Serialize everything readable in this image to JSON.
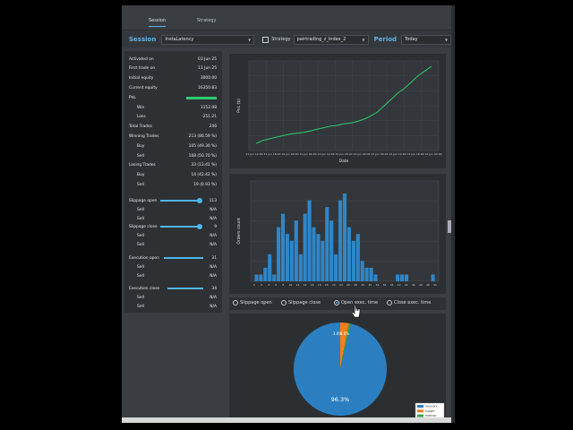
{
  "tabs": [
    {
      "label": "Session",
      "active": true
    },
    {
      "label": "Strategy",
      "active": false
    }
  ],
  "toolbar": {
    "session_label": "Session",
    "session_value": "InstaLatency",
    "strategy_checkbox_checked": false,
    "strategy_label": "Strategy",
    "strategy_value": "pairtrading_z_index_2",
    "period_label": "Period",
    "period_value": "Today"
  },
  "stats": [
    {
      "label": "Activated on",
      "value": "03 Jun 25",
      "sub": false
    },
    {
      "label": "First trade on",
      "value": "11 Jun 25",
      "sub": false
    },
    {
      "label": "Initial equity",
      "value": "3000.00",
      "sub": false
    },
    {
      "label": "Current equity",
      "value": "16350.83",
      "sub": false
    },
    {
      "label": "PnL",
      "value": "",
      "sub": false,
      "accent": true
    },
    {
      "label": "Win",
      "value": "1152.08",
      "sub": true
    },
    {
      "label": "Loss",
      "value": "-251.21",
      "sub": true
    },
    {
      "label": "Total Trades",
      "value": "246",
      "sub": false
    },
    {
      "label": "Winning Trades",
      "value": "213 (86.59 %)",
      "sub": false
    },
    {
      "label": "Buy",
      "value": "105 (49.30 %)",
      "sub": true
    },
    {
      "label": "Sell",
      "value": "108 (50.70 %)",
      "sub": true
    },
    {
      "label": "Losing Trades",
      "value": "33 (13.41 %)",
      "sub": false
    },
    {
      "label": "Buy",
      "value": "14 (42.42 %)",
      "sub": true
    },
    {
      "label": "Sell",
      "value": "19 (0.93 %)",
      "sub": true
    }
  ],
  "sliders": [
    {
      "label": "Slippage open",
      "value": "113",
      "level": 1.0,
      "rows": [
        {
          "label": "Sell",
          "value": "N/A"
        },
        {
          "label": "Sell",
          "value": "N/A"
        }
      ]
    },
    {
      "label": "Slippage close",
      "value": "9",
      "level": 1.0,
      "rows": [
        {
          "label": "Sell",
          "value": "N/A"
        },
        {
          "label": "Sell",
          "value": "N/A"
        }
      ]
    },
    {
      "label": "Execution open",
      "value": "31",
      "level": 1.0,
      "rows": [
        {
          "label": "Sell",
          "value": "N/A"
        },
        {
          "label": "Sell",
          "value": "N/A"
        }
      ]
    },
    {
      "label": "Execution close",
      "value": "34",
      "level": 1.0,
      "rows": [
        {
          "label": "Sell",
          "value": "N/A"
        },
        {
          "label": "Sell",
          "value": "N/A"
        }
      ]
    }
  ],
  "colors": {
    "accent": "#4fb6ec",
    "pnl_green": "#2ecc71",
    "pie_blue": "#2b7fc1",
    "pie_orange": "#f07f1c",
    "pie_green": "#3aa14a"
  },
  "radios": [
    {
      "label": "Slippage open",
      "selected": false
    },
    {
      "label": "Slippage close",
      "selected": false
    },
    {
      "label": "Open exec. time",
      "selected": true
    },
    {
      "label": "Close exec. time",
      "selected": false
    }
  ],
  "chart_data": [
    {
      "type": "line",
      "xlabel": "Date",
      "ylabel": "PnL ($)",
      "xticks": [
        "11 Jun 12:00",
        "11 Jun 18:00",
        "12 Jun 00:00",
        "12 Jun 06:00",
        "12 Jun 12:00",
        "12 Jun 18:00",
        "13 Jun 00:00",
        "13 Jun 06:00",
        "13 Jun 12:00",
        "13 Jun 18:00",
        "14 Jun 00:00"
      ],
      "yticks": [],
      "series": [
        {
          "values": [
            0.02,
            0.06,
            0.08,
            0.1,
            0.12,
            0.14,
            0.15,
            0.16,
            0.18,
            0.2,
            0.22,
            0.24,
            0.25,
            0.27,
            0.28,
            0.3,
            0.33,
            0.37,
            0.42,
            0.5,
            0.58,
            0.66,
            0.72,
            0.8,
            0.88,
            0.94,
            1.0
          ]
        }
      ],
      "grid": true
    },
    {
      "type": "bar",
      "ylabel": "Orders count",
      "xticks": [
        "0",
        "2",
        "4",
        "6",
        "8",
        "10",
        "12",
        "14",
        "16",
        "18",
        "20",
        "22",
        "24",
        "26",
        "28",
        "30",
        "32",
        "34",
        "36",
        "38",
        "40",
        "42",
        "44",
        "46",
        "48",
        "50"
      ],
      "yticks": [],
      "values": [
        1,
        1,
        2,
        4,
        1,
        8,
        10,
        7,
        6,
        9,
        4,
        10,
        12,
        8,
        7,
        6,
        11,
        9,
        4,
        12,
        13,
        8,
        6,
        7,
        3,
        2,
        2,
        1,
        0,
        0,
        0,
        0,
        1,
        1,
        1,
        0,
        0,
        0,
        0,
        0,
        1
      ],
      "grid": true
    },
    {
      "type": "pie",
      "slices": [
        {
          "label": "XAUUSD",
          "value": 96.3,
          "display": "96.3%"
        },
        {
          "label": "USDJPY",
          "value": 3.0,
          "display": "3.0%"
        },
        {
          "label": "EURUSD",
          "value": 0.7,
          "display": "0.6%"
        }
      ],
      "legend": "bottom-right"
    }
  ]
}
